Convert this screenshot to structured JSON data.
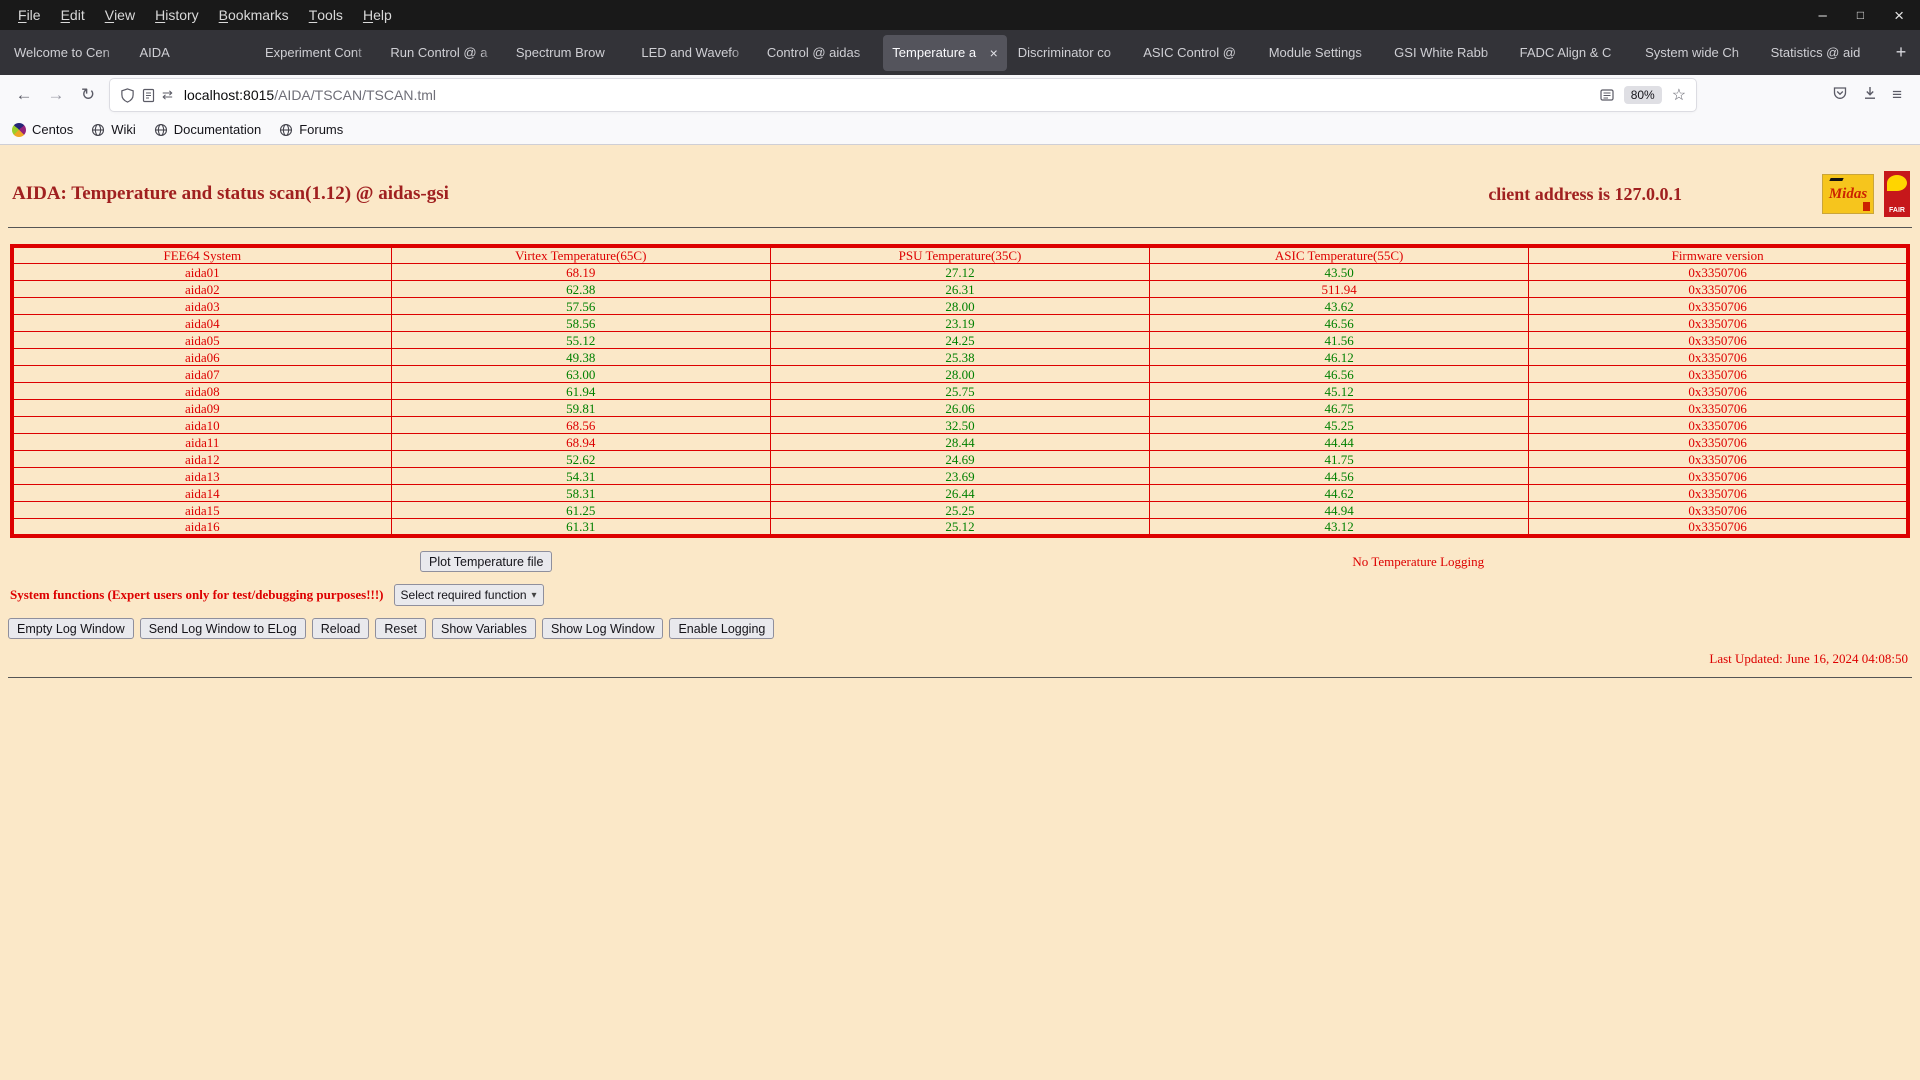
{
  "window": {
    "menus": [
      "File",
      "Edit",
      "View",
      "History",
      "Bookmarks",
      "Tools",
      "Help"
    ]
  },
  "icons": {
    "minimize": "–",
    "maximize": "□",
    "close": "×",
    "back": "←",
    "forward": "→",
    "reload": "↻",
    "new_tab": "+",
    "close_tab": "×",
    "star": "☆",
    "download": "↓",
    "menu": "≡",
    "permissions": "⇄",
    "select_arrow": "▾"
  },
  "tabs": [
    {
      "label": "Welcome to Cen",
      "active": false
    },
    {
      "label": "AIDA",
      "active": false
    },
    {
      "label": "Experiment Cont",
      "active": false
    },
    {
      "label": "Run Control @ a",
      "active": false
    },
    {
      "label": "Spectrum Brow",
      "active": false
    },
    {
      "label": "LED and Wavefo",
      "active": false
    },
    {
      "label": "Control @ aidas",
      "active": false
    },
    {
      "label": "Temperature a",
      "active": true
    },
    {
      "label": "Discriminator co",
      "active": false
    },
    {
      "label": "ASIC Control @",
      "active": false
    },
    {
      "label": "Module Settings",
      "active": false
    },
    {
      "label": "GSI White Rabb",
      "active": false
    },
    {
      "label": "FADC Align & C",
      "active": false
    },
    {
      "label": "System wide Ch",
      "active": false
    },
    {
      "label": "Statistics @ aid",
      "active": false
    }
  ],
  "navbar": {
    "url_host": "localhost:8015",
    "url_path": "/AIDA/TSCAN/TSCAN.tml",
    "zoom": "80%"
  },
  "bookmarks": [
    {
      "label": "Centos",
      "icon": "centos"
    },
    {
      "label": "Wiki",
      "icon": "globe"
    },
    {
      "label": "Documentation",
      "icon": "globe"
    },
    {
      "label": "Forums",
      "icon": "globe"
    }
  ],
  "page": {
    "title": "AIDA: Temperature and status scan(1.12) @ aidas-gsi",
    "client_address": "client address is 127.0.0.1",
    "logos": {
      "midas": "Midas",
      "fair": "FAIR"
    },
    "table": {
      "columns": [
        "FEE64 System",
        "Virtex Temperature(65C)",
        "PSU Temperature(35C)",
        "ASIC Temperature(55C)",
        "Firmware version"
      ],
      "limits": [
        65,
        35,
        55
      ],
      "rows": [
        [
          "aida01",
          "68.19",
          "27.12",
          "43.50",
          "0x3350706"
        ],
        [
          "aida02",
          "62.38",
          "26.31",
          "511.94",
          "0x3350706"
        ],
        [
          "aida03",
          "57.56",
          "28.00",
          "43.62",
          "0x3350706"
        ],
        [
          "aida04",
          "58.56",
          "23.19",
          "46.56",
          "0x3350706"
        ],
        [
          "aida05",
          "55.12",
          "24.25",
          "41.56",
          "0x3350706"
        ],
        [
          "aida06",
          "49.38",
          "25.38",
          "46.12",
          "0x3350706"
        ],
        [
          "aida07",
          "63.00",
          "28.00",
          "46.56",
          "0x3350706"
        ],
        [
          "aida08",
          "61.94",
          "25.75",
          "45.12",
          "0x3350706"
        ],
        [
          "aida09",
          "59.81",
          "26.06",
          "46.75",
          "0x3350706"
        ],
        [
          "aida10",
          "68.56",
          "32.50",
          "45.25",
          "0x3350706"
        ],
        [
          "aida11",
          "68.94",
          "28.44",
          "44.44",
          "0x3350706"
        ],
        [
          "aida12",
          "52.62",
          "24.69",
          "41.75",
          "0x3350706"
        ],
        [
          "aida13",
          "54.31",
          "23.69",
          "44.56",
          "0x3350706"
        ],
        [
          "aida14",
          "58.31",
          "26.44",
          "44.62",
          "0x3350706"
        ],
        [
          "aida15",
          "61.25",
          "25.25",
          "44.94",
          "0x3350706"
        ],
        [
          "aida16",
          "61.31",
          "25.12",
          "43.12",
          "0x3350706"
        ]
      ]
    },
    "plot_button": "Plot Temperature file",
    "logging_status": "No Temperature Logging",
    "system_functions_label": "System functions (Expert users only for test/debugging purposes!!!)",
    "function_select_value": "Select required function",
    "action_buttons": [
      "Empty Log Window",
      "Send Log Window to ELog",
      "Reload",
      "Reset",
      "Show Variables",
      "Show Log Window",
      "Enable Logging"
    ],
    "last_updated": "Last Updated: June 16, 2024 04:08:50"
  },
  "colors": {
    "page_bg": "#fbe8c8",
    "accent_red": "#dd0000",
    "ok_green": "#008000",
    "title_red": "#a02020"
  }
}
